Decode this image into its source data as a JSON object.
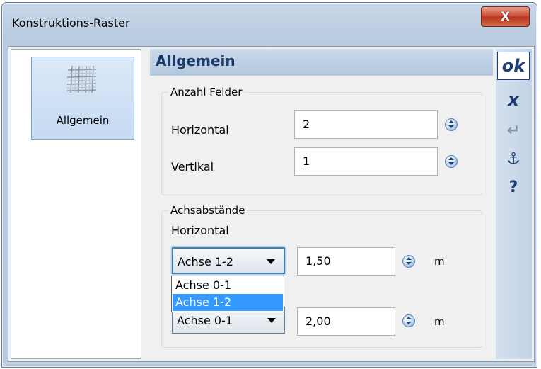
{
  "window": {
    "title": "Konstruktions-Raster",
    "close_label": "X"
  },
  "sidebar": {
    "items": [
      {
        "label": "Allgemein",
        "icon": "grid-icon"
      }
    ]
  },
  "main": {
    "heading": "Allgemein",
    "anzahl_felder": {
      "title": "Anzahl Felder",
      "horizontal": {
        "label": "Horizontal",
        "value": "2"
      },
      "vertikal": {
        "label": "Vertikal",
        "value": "1"
      }
    },
    "achsabstaende": {
      "title": "Achsabstände",
      "horizontal_label": "Horizontal",
      "row1": {
        "selected": "Achse 1-2",
        "value": "1,50",
        "unit": "m"
      },
      "row2": {
        "selected": "Achse 0-1",
        "value": "2,00",
        "unit": "m"
      },
      "dropdown_options": [
        "Achse 0-1",
        "Achse 1-2"
      ],
      "dropdown_highlighted": "Achse 1-2"
    }
  },
  "toolbar": {
    "ok": "ok",
    "cancel": "x",
    "enter": "↵",
    "anchor": "⚓",
    "help": "?"
  },
  "colors": {
    "accent": "#1b3c74",
    "selection": "#3399ff",
    "close": "#c9452c"
  }
}
